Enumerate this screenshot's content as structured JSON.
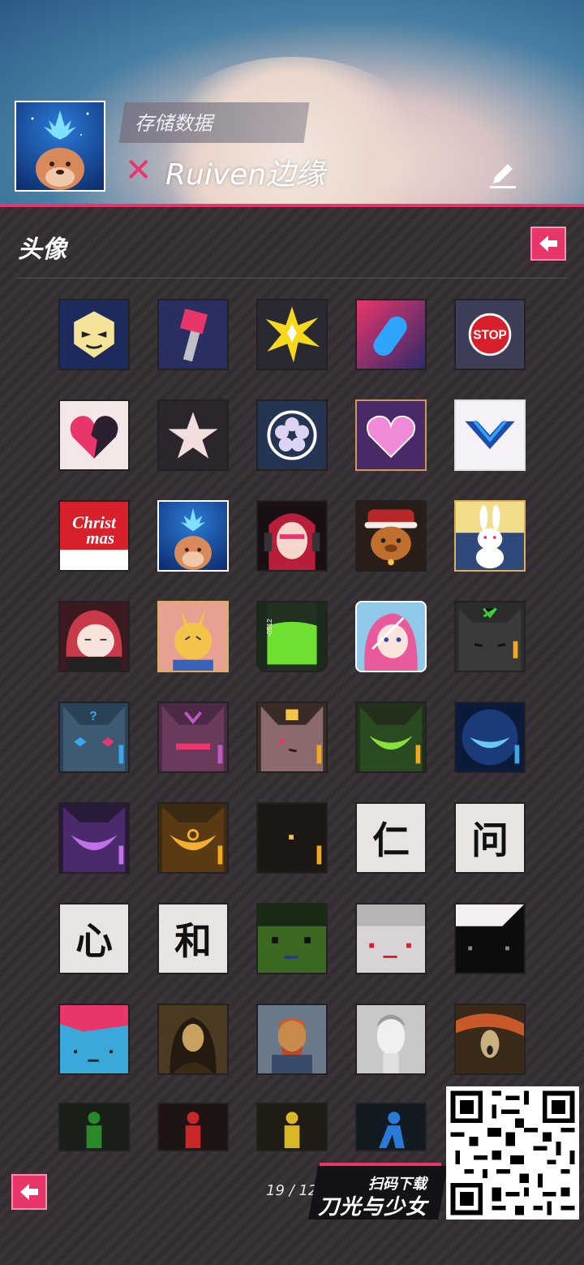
{
  "header": {
    "save_label": "存储数据",
    "player_name": "Ruiven边缘",
    "status_icon": "x-icon",
    "edit_icon": "pencil-icon"
  },
  "section": {
    "title": "头像",
    "back_icon": "arrow-left-icon"
  },
  "avatars": [
    "mask-face-icon",
    "red-hammer-icon",
    "explosion-icon",
    "blue-pill-icon",
    "stop-sign-icon",
    "broken-heart-icon",
    "star-icon",
    "flower-crest-icon",
    "pink-heart-icon",
    "blue-chevron-icon",
    "christmas-icon",
    "reindeer-dog-icon",
    "red-hair-girl-icon",
    "bear-hat-icon",
    "white-rabbit-icon",
    "red-girl-chibi-icon",
    "yellow-bunny-icon",
    "green-bottle-icon",
    "pink-hair-girl-icon",
    "cat-mask-green-icon",
    "cat-mask-blue-icon",
    "cat-mask-pink-icon",
    "cat-mask-skull-icon",
    "cat-mask-green-smile-icon",
    "cat-mask-dark-blue-icon",
    "cat-mask-purple-icon",
    "cat-mask-gold-icon",
    "dark-square-icon",
    "kanji-ren-icon",
    "kanji-wen-icon",
    "kanji-xin-icon",
    "kanji-he-icon",
    "green-robot-face-icon",
    "white-face-icon",
    "black-face-icon",
    "pink-blue-face-icon",
    "mona-lisa-icon",
    "van-gogh-icon",
    "david-statue-icon",
    "the-scream-icon",
    "green-figure-icon",
    "red-figure-icon",
    "yellow-figure-icon",
    "blue-figure-icon"
  ],
  "kanji": {
    "ren": "仁",
    "wen": "问",
    "xin": "心",
    "he": "和"
  },
  "christmas_text": {
    "line1": "Christ",
    "line2": "mas"
  },
  "stop_text": "STOP",
  "bottle_text": "-0512",
  "footer": {
    "page": "19 / 12",
    "promo_top": "扫码下载",
    "promo_main": "刀光与少女"
  },
  "colors": {
    "accent": "#e8366b",
    "background": "#3a3438"
  }
}
